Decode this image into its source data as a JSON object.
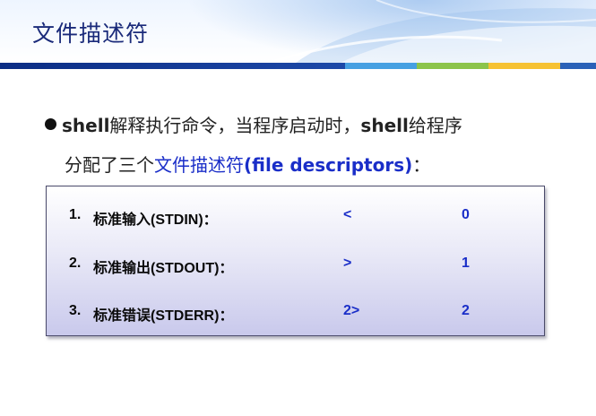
{
  "slide": {
    "title": "文件描述符",
    "bullet": {
      "part1": "shell",
      "part2": "解释执行命令，当程序启动时，",
      "part3": "shell",
      "part4": "给程序",
      "part5": "分配了三个",
      "part6": "文件描述符",
      "part7": "(file descriptors)",
      "part8": "："
    },
    "table": [
      {
        "num": "1.",
        "label": "标准输入(STDIN)：",
        "symbol": "<",
        "fd": "0"
      },
      {
        "num": "2.",
        "label": "标准输出(STDOUT)：",
        "symbol": ">",
        "fd": "1"
      },
      {
        "num": "3.",
        "label": "标准错误(STDERR)：",
        "symbol": "2>",
        "fd": "2"
      }
    ]
  },
  "colors": {
    "title": "#1a2a7a",
    "accent_blue": "#1a2ec8",
    "rule_dark": "#0b2d84",
    "rule_blue": "#46a0e2",
    "rule_green": "#8cc44a",
    "rule_yellow": "#f6c232"
  }
}
